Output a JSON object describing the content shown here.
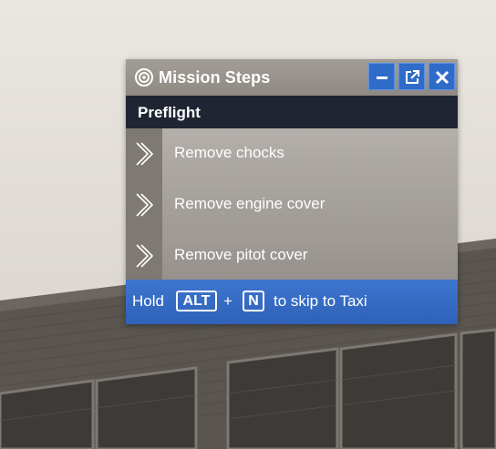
{
  "panel": {
    "title": "Mission Steps",
    "title_icon": "target-icon",
    "window_buttons": {
      "minimize_icon": "minimize-icon",
      "popout_icon": "popout-icon",
      "close_icon": "close-icon"
    }
  },
  "section": {
    "title": "Preflight"
  },
  "steps": [
    {
      "label": "Remove chocks",
      "icon": "chevron-right-icon"
    },
    {
      "label": "Remove engine cover",
      "icon": "chevron-right-icon"
    },
    {
      "label": "Remove pitot cover",
      "icon": "chevron-right-icon"
    }
  ],
  "hint": {
    "prefix": "Hold",
    "key1": "ALT",
    "plus": "+",
    "key2": "N",
    "suffix": "to skip to Taxi"
  },
  "colors": {
    "accent_blue": "#2f6cc9",
    "header_dark": "#1f2533",
    "titlebar_gray": "#9a948e"
  }
}
